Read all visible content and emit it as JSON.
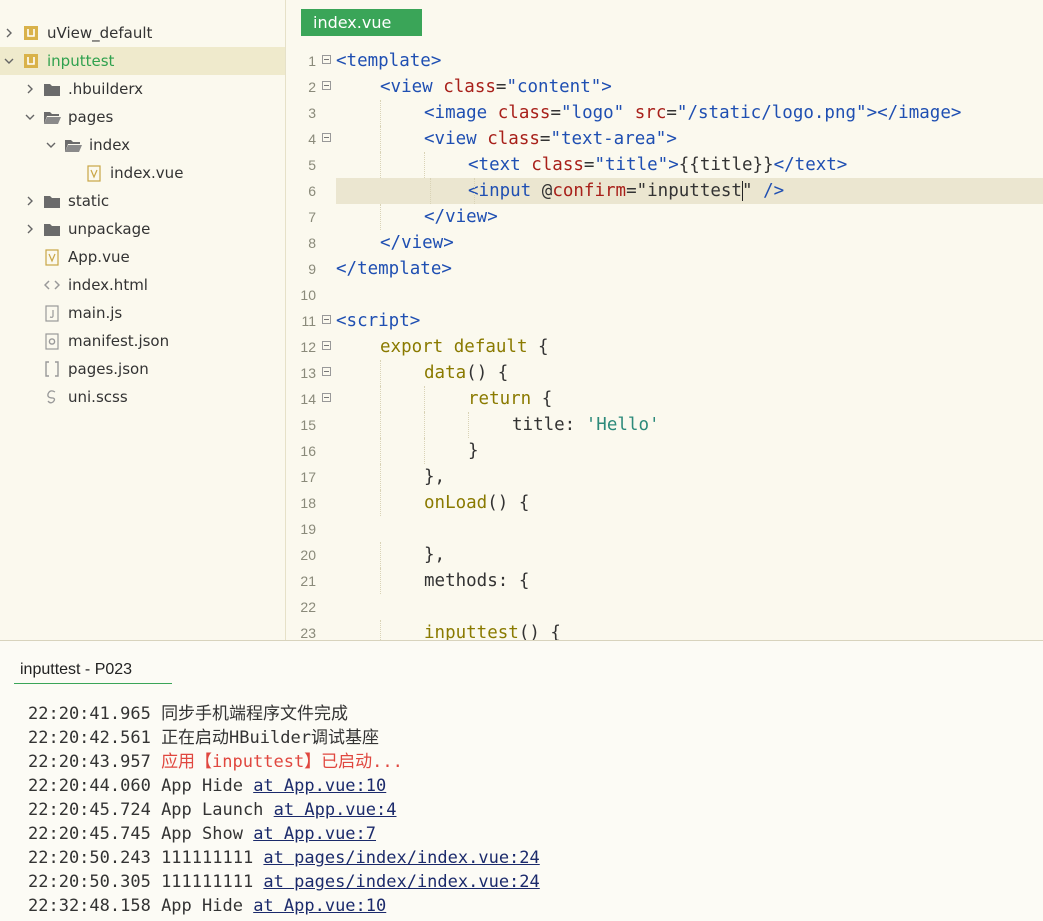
{
  "sidebar": {
    "projects": [
      {
        "name": "uView_default",
        "expanded": false
      },
      {
        "name": "inputtest",
        "expanded": true
      }
    ],
    "tree": [
      {
        "label": ".hbuilderx",
        "type": "folder",
        "depth": 1,
        "expanded": false
      },
      {
        "label": "pages",
        "type": "folder-open",
        "depth": 1,
        "expanded": true
      },
      {
        "label": "index",
        "type": "folder-open",
        "depth": 2,
        "expanded": true
      },
      {
        "label": "index.vue",
        "type": "vue-file",
        "depth": 3
      },
      {
        "label": "static",
        "type": "folder",
        "depth": 1,
        "expanded": false
      },
      {
        "label": "unpackage",
        "type": "folder",
        "depth": 1,
        "expanded": false
      },
      {
        "label": "App.vue",
        "type": "vue-file",
        "depth": 1
      },
      {
        "label": "index.html",
        "type": "html-file",
        "depth": 1
      },
      {
        "label": "main.js",
        "type": "js-file",
        "depth": 1
      },
      {
        "label": "manifest.json",
        "type": "json-gear-file",
        "depth": 1
      },
      {
        "label": "pages.json",
        "type": "json-file",
        "depth": 1
      },
      {
        "label": "uni.scss",
        "type": "scss-file",
        "depth": 1
      }
    ]
  },
  "editor": {
    "tab_label": "index.vue",
    "current_line": 6,
    "lines": [
      {
        "n": "1",
        "fold": true,
        "indent": 0,
        "parts": [
          [
            "tg",
            "<template>"
          ]
        ]
      },
      {
        "n": "2",
        "fold": true,
        "indent": 1,
        "parts": [
          [
            "tg",
            "<view "
          ],
          [
            "at",
            "class"
          ],
          [
            "pl",
            "="
          ],
          [
            "st",
            "\"content\""
          ],
          [
            "tg",
            ">"
          ]
        ]
      },
      {
        "n": "3",
        "fold": false,
        "indent": 2,
        "parts": [
          [
            "tg",
            "<image "
          ],
          [
            "at",
            "class"
          ],
          [
            "pl",
            "="
          ],
          [
            "st",
            "\"logo\""
          ],
          [
            "pl",
            " "
          ],
          [
            "at",
            "src"
          ],
          [
            "pl",
            "="
          ],
          [
            "st",
            "\"/static/logo.png\""
          ],
          [
            "tg",
            "></image>"
          ]
        ]
      },
      {
        "n": "4",
        "fold": true,
        "indent": 2,
        "parts": [
          [
            "tg",
            "<view "
          ],
          [
            "at",
            "class"
          ],
          [
            "pl",
            "="
          ],
          [
            "st",
            "\"text-area\""
          ],
          [
            "tg",
            ">"
          ]
        ]
      },
      {
        "n": "5",
        "fold": false,
        "indent": 3,
        "parts": [
          [
            "tg",
            "<text "
          ],
          [
            "at",
            "class"
          ],
          [
            "pl",
            "="
          ],
          [
            "st",
            "\"title\""
          ],
          [
            "tg",
            ">"
          ],
          [
            "pl",
            "{{title}}"
          ],
          [
            "tg",
            "</text>"
          ]
        ]
      },
      {
        "n": "6",
        "fold": false,
        "indent": 3,
        "parts": [
          [
            "tg",
            "<input "
          ],
          [
            "pl",
            "@"
          ],
          [
            "at",
            "confirm"
          ],
          [
            "pl",
            "=\"inputtest"
          ],
          [
            "cursor",
            ""
          ],
          [
            "pl",
            "\" "
          ],
          [
            "tg",
            "/>"
          ]
        ]
      },
      {
        "n": "7",
        "fold": false,
        "indent": 2,
        "parts": [
          [
            "tg",
            "</view>"
          ]
        ]
      },
      {
        "n": "8",
        "fold": false,
        "indent": 1,
        "parts": [
          [
            "tg",
            "</view>"
          ]
        ]
      },
      {
        "n": "9",
        "fold": false,
        "indent": 0,
        "parts": [
          [
            "tg",
            "</template>"
          ]
        ]
      },
      {
        "n": "10",
        "fold": false,
        "indent": 0,
        "parts": []
      },
      {
        "n": "11",
        "fold": true,
        "indent": 0,
        "parts": [
          [
            "tg",
            "<script>"
          ]
        ]
      },
      {
        "n": "12",
        "fold": true,
        "indent": 1,
        "parts": [
          [
            "kw",
            "export default "
          ],
          [
            "pl",
            "{"
          ]
        ]
      },
      {
        "n": "13",
        "fold": true,
        "indent": 2,
        "parts": [
          [
            "fn",
            "data"
          ],
          [
            "pl",
            "() {"
          ]
        ]
      },
      {
        "n": "14",
        "fold": true,
        "indent": 3,
        "parts": [
          [
            "kw",
            "return "
          ],
          [
            "pl",
            "{"
          ]
        ]
      },
      {
        "n": "15",
        "fold": false,
        "indent": 4,
        "parts": [
          [
            "pl",
            "title: "
          ],
          [
            "sq",
            "'Hello'"
          ]
        ]
      },
      {
        "n": "16",
        "fold": false,
        "indent": 3,
        "parts": [
          [
            "pl",
            "}"
          ]
        ]
      },
      {
        "n": "17",
        "fold": false,
        "indent": 2,
        "parts": [
          [
            "pl",
            "},"
          ]
        ]
      },
      {
        "n": "18",
        "fold": false,
        "indent": 2,
        "parts": [
          [
            "fn",
            "onLoad"
          ],
          [
            "pl",
            "() {"
          ]
        ]
      },
      {
        "n": "19",
        "fold": false,
        "indent": 0,
        "parts": []
      },
      {
        "n": "20",
        "fold": false,
        "indent": 2,
        "parts": [
          [
            "pl",
            "},"
          ]
        ]
      },
      {
        "n": "21",
        "fold": false,
        "indent": 2,
        "parts": [
          [
            "pl",
            "methods: {"
          ]
        ]
      },
      {
        "n": "22",
        "fold": false,
        "indent": 0,
        "parts": []
      },
      {
        "n": "23",
        "fold": false,
        "indent": 2,
        "parts": [
          [
            "fn",
            "inputtest"
          ],
          [
            "pl",
            "() {"
          ]
        ]
      }
    ]
  },
  "console": {
    "tab_label": "inputtest - P023",
    "logs": [
      {
        "time": "22:20:41.965",
        "msg": "同步手机端程序文件完成",
        "link": "",
        "warn": false
      },
      {
        "time": "22:20:42.561",
        "msg": "正在启动HBuilder调试基座",
        "link": "",
        "warn": false
      },
      {
        "time": "22:20:43.957",
        "msg": "应用【inputtest】已启动...",
        "link": "",
        "warn": true
      },
      {
        "time": "22:20:44.060",
        "msg": "App Hide ",
        "link": "at App.vue:10",
        "warn": false
      },
      {
        "time": "22:20:45.724",
        "msg": "App Launch ",
        "link": "at App.vue:4",
        "warn": false
      },
      {
        "time": "22:20:45.745",
        "msg": "App Show ",
        "link": "at App.vue:7",
        "warn": false
      },
      {
        "time": "22:20:50.243",
        "msg": "111111111 ",
        "link": "at pages/index/index.vue:24",
        "warn": false
      },
      {
        "time": "22:20:50.305",
        "msg": "111111111 ",
        "link": "at pages/index/index.vue:24",
        "warn": false
      },
      {
        "time": "22:32:48.158",
        "msg": "App Hide ",
        "link": "at App.vue:10",
        "warn": false
      }
    ]
  },
  "colors": {
    "accent": "#3aa558",
    "warn": "#e0473f",
    "link": "#1b2a6b"
  }
}
